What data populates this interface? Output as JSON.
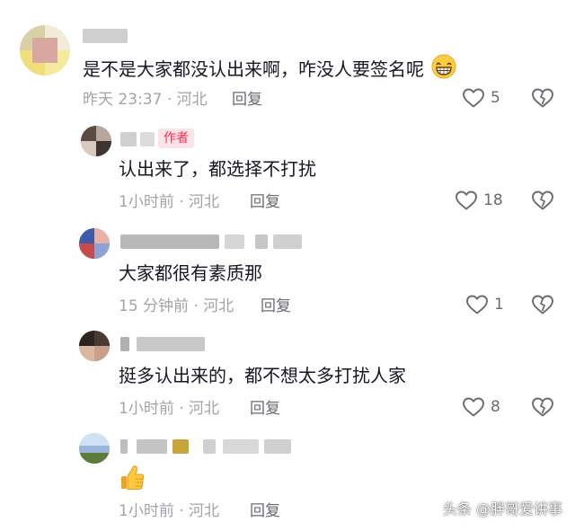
{
  "comments": [
    {
      "text": "是不是大家都没认出来啊，咋没人要签名呢",
      "time": "昨天 23:37",
      "location": "河北",
      "reply_label": "回复",
      "likes": "5"
    },
    {
      "author_badge": "作者",
      "text": "认出来了，都选择不打扰",
      "time": "1小时前",
      "location": "河北",
      "reply_label": "回复",
      "likes": "18"
    },
    {
      "text": "大家都很有素质那",
      "time": "15 分钟前",
      "location": "河北",
      "reply_label": "回复",
      "likes": "1"
    },
    {
      "text": "挺多认出来的，都不想太多打扰人家",
      "time": "1小时前",
      "location": "河北",
      "reply_label": "回复",
      "likes": "8"
    },
    {
      "text": "",
      "time": "1小时前",
      "location": "河北",
      "reply_label": "回复",
      "likes": ""
    }
  ],
  "separator": "·",
  "watermark": "头条 @胖哥爱讲事",
  "colors": {
    "accent": "#fe2c55",
    "meta_gray": "#a3a3a8"
  },
  "icons": [
    "heart-icon",
    "broken-heart-icon",
    "grinning-emoji-icon",
    "thumbs-up-emoji-icon"
  ]
}
